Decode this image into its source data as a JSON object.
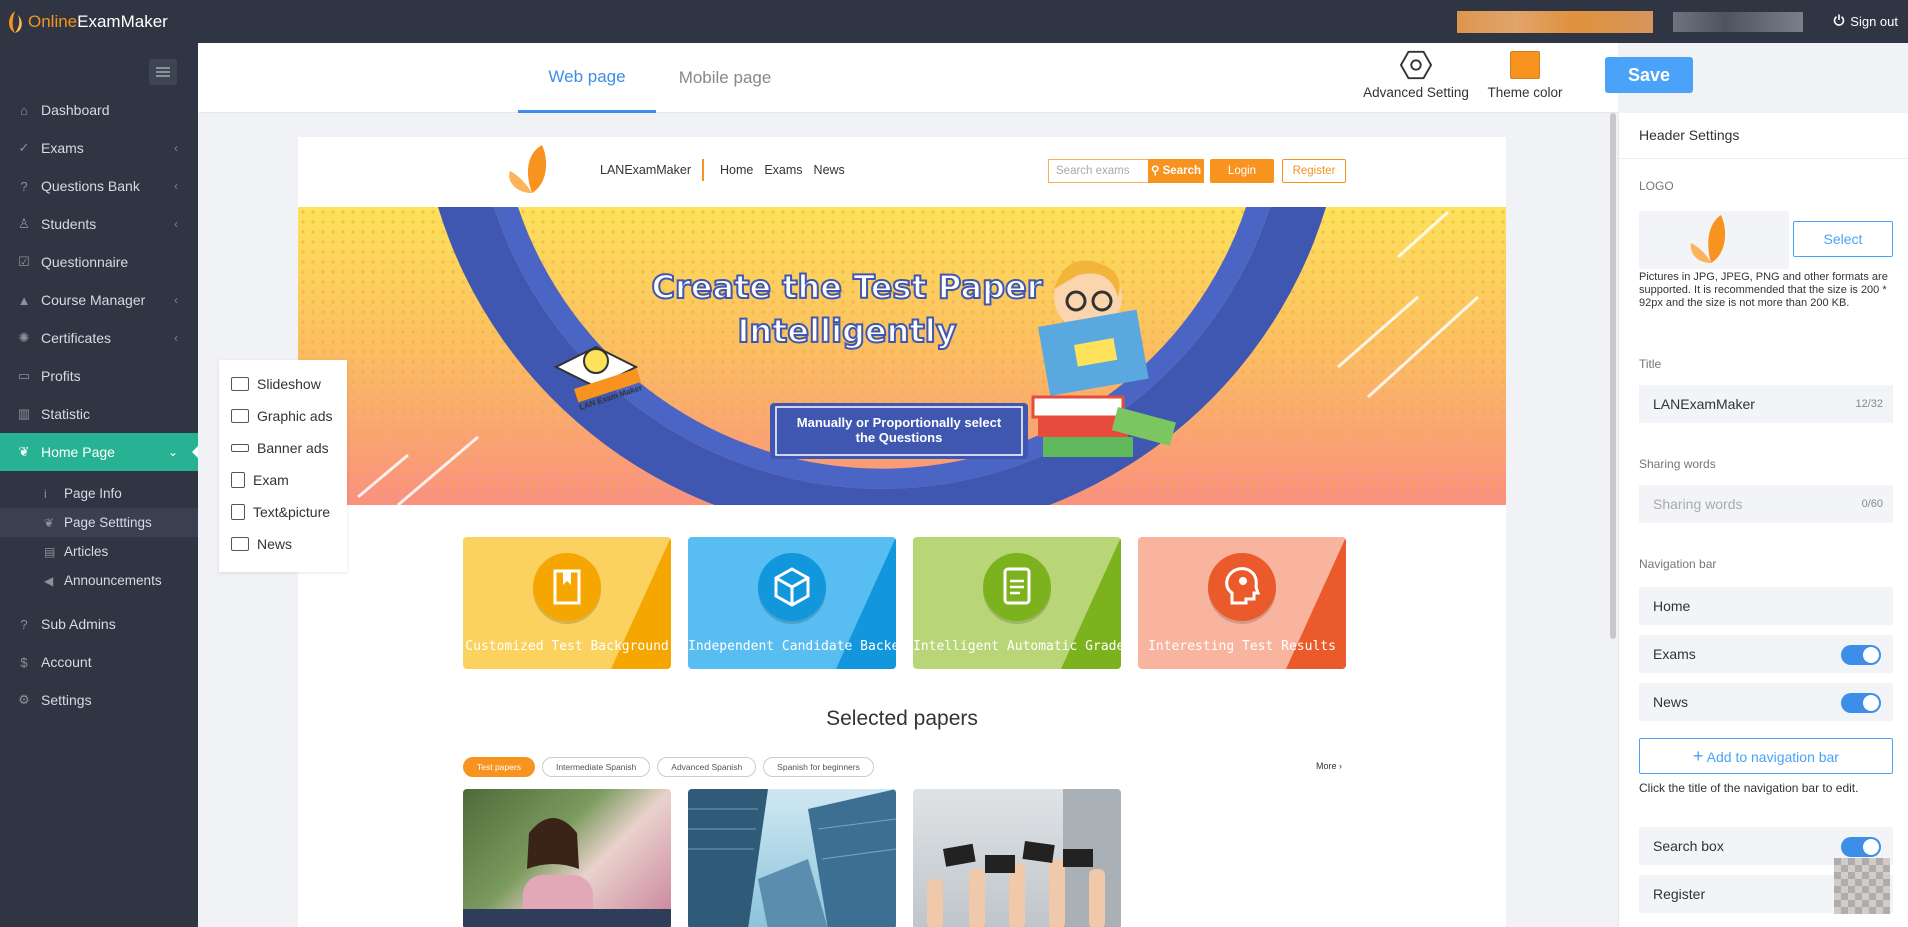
{
  "app": {
    "brand_prefix": "Online",
    "brand_suffix": "ExamMaker",
    "sign_out": "Sign out"
  },
  "sidebar": {
    "items": [
      {
        "label": "Dashboard",
        "icon": "home-icon"
      },
      {
        "label": "Exams",
        "icon": "check-circle-icon"
      },
      {
        "label": "Questions Bank",
        "icon": "question-icon"
      },
      {
        "label": "Students",
        "icon": "users-icon"
      },
      {
        "label": "Questionnaire",
        "icon": "checkbox-icon"
      },
      {
        "label": "Course Manager",
        "icon": "graduation-cap-icon"
      },
      {
        "label": "Certificates",
        "icon": "certificate-icon"
      },
      {
        "label": "Profits",
        "icon": "wallet-icon"
      },
      {
        "label": "Statistic",
        "icon": "bar-chart-icon"
      },
      {
        "label": "Home Page",
        "icon": "leaf-icon"
      },
      {
        "label": "Sub Admins",
        "icon": "question-icon"
      },
      {
        "label": "Account",
        "icon": "dollar-icon"
      },
      {
        "label": "Settings",
        "icon": "gear-icon"
      }
    ],
    "sub_items": [
      {
        "label": "Page Info"
      },
      {
        "label": "Page Setttings"
      },
      {
        "label": "Articles"
      },
      {
        "label": "Announcements"
      }
    ]
  },
  "toolbar": {
    "tabs": [
      {
        "label": "Web page"
      },
      {
        "label": "Mobile page"
      }
    ],
    "advanced_setting": "Advanced Setting",
    "theme_color_label": "Theme color",
    "theme_color": "#f7931e",
    "save": "Save"
  },
  "preview": {
    "site_title": "LANExamMaker",
    "nav": [
      "Home",
      "Exams",
      "News"
    ],
    "search_placeholder": "Search exams",
    "search_button": "Search",
    "login": "Login",
    "register": "Register",
    "banner": {
      "headline_1": "Create the Test Paper",
      "headline_2": "Intelligently",
      "sub_1": "Manually or Proportionally select",
      "sub_2": "the Questions",
      "badge": "LAN Exam Maker"
    },
    "cards": [
      {
        "text": "Customized Test Background",
        "color": "#fbd25f",
        "accent": "#f6a600"
      },
      {
        "text": "Independent Candidate Backend",
        "color": "#58bdf0",
        "accent": "#1296dc"
      },
      {
        "text": "Intelligent Automatic Grade",
        "color": "#b8d678",
        "accent": "#7cb21e"
      },
      {
        "text": "Interesting Test Results",
        "color": "#f8b49e",
        "accent": "#ea5a2a"
      }
    ],
    "selected_title": "Selected papers",
    "pills": [
      "Test papers",
      "Intermediate Spanish",
      "Advanced Spanish",
      "Spanish for beginners"
    ],
    "more": "More"
  },
  "add_panel": {
    "items": [
      {
        "label": "Slideshow"
      },
      {
        "label": "Graphic ads"
      },
      {
        "label": "Banner ads"
      },
      {
        "label": "Exam"
      },
      {
        "label": "Text&picture"
      },
      {
        "label": "News"
      }
    ]
  },
  "right_panel": {
    "header": "Header Settings",
    "logo_label": "LOGO",
    "select": "Select",
    "logo_help": "Pictures in JPG, JPEG, PNG and other formats are supported. It is recommended that the size is 200 * 92px and the size is not more than 200 KB.",
    "title_label": "Title",
    "title_value": "LANExamMaker",
    "title_count": "12/32",
    "sharing_label": "Sharing words",
    "sharing_placeholder": "Sharing words",
    "sharing_count": "0/60",
    "nav_label": "Navigation bar",
    "nav_items": [
      {
        "label": "Home",
        "toggle": false
      },
      {
        "label": "Exams",
        "toggle": true
      },
      {
        "label": "News",
        "toggle": true
      }
    ],
    "add_nav": "Add to navigation bar",
    "nav_note": "Click the title of the navigation bar to edit.",
    "search_box": "Search box",
    "register": "Register"
  }
}
